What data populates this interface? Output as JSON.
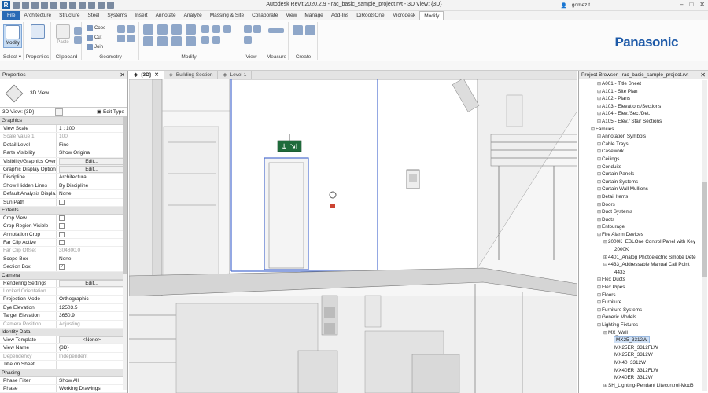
{
  "title": {
    "window_title": "Autodesk Revit 2020.2.9 - rac_basic_sample_project.rvt - 3D View: {3D}",
    "user": "gomez.t"
  },
  "ribbon_tabs": [
    "File",
    "Architecture",
    "Structure",
    "Steel",
    "Systems",
    "Insert",
    "Annotate",
    "Analyze",
    "Massing & Site",
    "Collaborate",
    "View",
    "Manage",
    "Add-Ins",
    "DiRootsOne",
    "Microdesk",
    "Modify"
  ],
  "ribbon": {
    "select": {
      "modify_label": "Modify",
      "group_label": "Select ▾"
    },
    "properties": {
      "group_label": "Properties"
    },
    "clipboard": {
      "paste_label": "Paste",
      "group_label": "Clipboard"
    },
    "geometry": {
      "cope_label": "Cope",
      "cut_label": "Cut",
      "join_label": "Join",
      "group_label": "Geometry"
    },
    "modify_group_label": "Modify",
    "view_group_label": "View",
    "measure_group_label": "Measure",
    "create_group_label": "Create"
  },
  "brand": "Panasonic",
  "properties_panel": {
    "header": "Properties",
    "type_name": "3D View",
    "selector_value": "3D View: {3D}",
    "edit_type": "Edit Type",
    "rows": [
      {
        "section": "Graphics"
      },
      {
        "k": "View Scale",
        "v": "1 : 100"
      },
      {
        "k": "Scale Value    1",
        "v": "100",
        "dis": true
      },
      {
        "k": "Detail Level",
        "v": "Fine"
      },
      {
        "k": "Parts Visibility",
        "v": "Show Original"
      },
      {
        "k": "Visibility/Graphics Over...",
        "v": "Edit...",
        "btn": true
      },
      {
        "k": "Graphic Display Options",
        "v": "Edit...",
        "btn": true
      },
      {
        "k": "Discipline",
        "v": "Architectural"
      },
      {
        "k": "Show Hidden Lines",
        "v": "By Discipline"
      },
      {
        "k": "Default Analysis Displa...",
        "v": "None"
      },
      {
        "k": "Sun Path",
        "chk": false
      },
      {
        "section": "Extents"
      },
      {
        "k": "Crop View",
        "chk": false
      },
      {
        "k": "Crop Region Visible",
        "chk": false
      },
      {
        "k": "Annotation Crop",
        "chk": false
      },
      {
        "k": "Far Clip Active",
        "chk": false
      },
      {
        "k": "Far Clip Offset",
        "v": "304800.0",
        "dis": true
      },
      {
        "k": "Scope Box",
        "v": "None"
      },
      {
        "k": "Section Box",
        "chk": true
      },
      {
        "section": "Camera"
      },
      {
        "k": "Rendering Settings",
        "v": "Edit...",
        "btn": true
      },
      {
        "k": "Locked Orientation",
        "v": "",
        "dis": true
      },
      {
        "k": "Projection Mode",
        "v": "Orthographic"
      },
      {
        "k": "Eye Elevation",
        "v": "12503.5"
      },
      {
        "k": "Target Elevation",
        "v": "3650.9"
      },
      {
        "k": "Camera Position",
        "v": "Adjusting",
        "dis": true
      },
      {
        "section": "Identity Data"
      },
      {
        "k": "View Template",
        "v": "<None>",
        "btn": true
      },
      {
        "k": "View Name",
        "v": "{3D}"
      },
      {
        "k": "Dependency",
        "v": "Independent",
        "dis": true
      },
      {
        "k": "Title on Sheet",
        "v": ""
      },
      {
        "section": "Phasing"
      },
      {
        "k": "Phase Filter",
        "v": "Show All"
      },
      {
        "k": "Phase",
        "v": "Working Drawings"
      }
    ]
  },
  "view_tabs": [
    {
      "label": "{3D}",
      "active": true
    },
    {
      "label": "Building Section",
      "active": false
    },
    {
      "label": "Level 1",
      "active": false
    }
  ],
  "project_browser": {
    "header": "Project Browser - rac_basic_sample_project.rvt",
    "items": [
      {
        "label": "A001 - Title Sheet",
        "d": 1
      },
      {
        "label": "A101 - Site Plan",
        "d": 1
      },
      {
        "label": "A102 - Plans",
        "d": 1
      },
      {
        "label": "A103 - Elevations/Sections",
        "d": 1
      },
      {
        "label": "A104 - Elev./Sec./Det.",
        "d": 1
      },
      {
        "label": "A105 - Elev./ Stair Sections",
        "d": 1
      },
      {
        "label": "Families",
        "d": 0,
        "exp": true
      },
      {
        "label": "Annotation Symbols",
        "d": 1
      },
      {
        "label": "Cable Trays",
        "d": 1
      },
      {
        "label": "Casework",
        "d": 1
      },
      {
        "label": "Ceilings",
        "d": 1
      },
      {
        "label": "Conduits",
        "d": 1
      },
      {
        "label": "Curtain Panels",
        "d": 1
      },
      {
        "label": "Curtain Systems",
        "d": 1
      },
      {
        "label": "Curtain Wall Mullions",
        "d": 1
      },
      {
        "label": "Detail Items",
        "d": 1
      },
      {
        "label": "Doors",
        "d": 1
      },
      {
        "label": "Duct Systems",
        "d": 1
      },
      {
        "label": "Ducts",
        "d": 1
      },
      {
        "label": "Entourage",
        "d": 1
      },
      {
        "label": "Fire Alarm Devices",
        "d": 1,
        "exp": true
      },
      {
        "label": "2000K_EBLOne Control Panel with Key",
        "d": 2,
        "exp": true
      },
      {
        "label": "2000K",
        "d": 3
      },
      {
        "label": "4401_Analog Photoelectric Smoke Dete",
        "d": 2
      },
      {
        "label": "4433_Addressable Manual Call Point",
        "d": 2,
        "exp": true
      },
      {
        "label": "4433",
        "d": 3
      },
      {
        "label": "Flex Ducts",
        "d": 1
      },
      {
        "label": "Flex Pipes",
        "d": 1
      },
      {
        "label": "Floors",
        "d": 1
      },
      {
        "label": "Furniture",
        "d": 1
      },
      {
        "label": "Furniture Systems",
        "d": 1
      },
      {
        "label": "Generic Models",
        "d": 1
      },
      {
        "label": "Lighting Fixtures",
        "d": 1,
        "exp": true
      },
      {
        "label": "MX_Wall",
        "d": 2,
        "exp": true
      },
      {
        "label": "MX25_3312W",
        "d": 3,
        "sel": true
      },
      {
        "label": "MX25ER_3312FLW",
        "d": 3
      },
      {
        "label": "MX25ER_3312W",
        "d": 3
      },
      {
        "label": "MX40_3312W",
        "d": 3
      },
      {
        "label": "MX40ER_3312FLW",
        "d": 3
      },
      {
        "label": "MX40ER_3312W",
        "d": 3
      },
      {
        "label": "SH_Lighting-Pendant Litecontrol-Mod6",
        "d": 2
      }
    ]
  }
}
